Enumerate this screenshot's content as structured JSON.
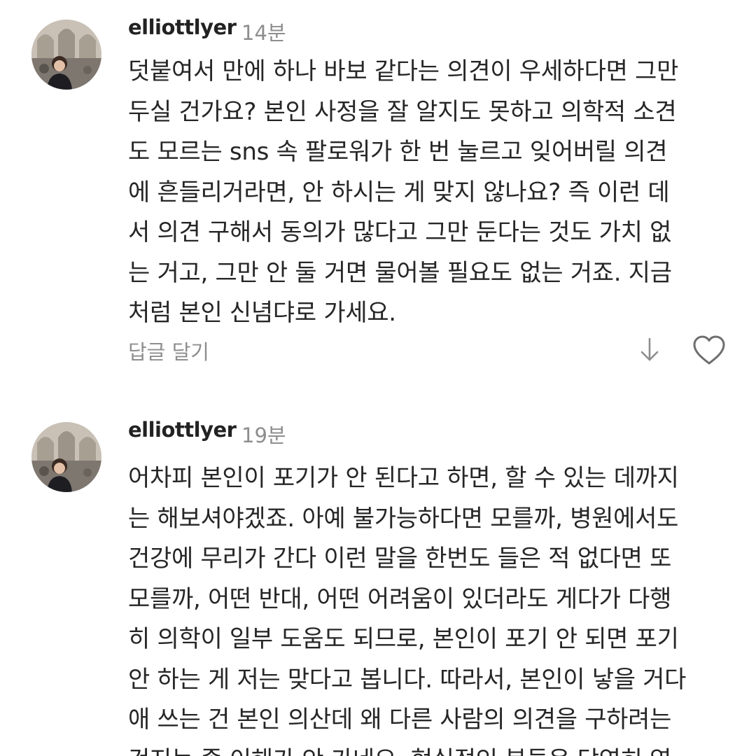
{
  "comments": [
    {
      "username": "elliottlyer",
      "timestamp": "14분",
      "lines": [
        "덧붙여서 만에 하나 바보 같다는 의견이 우세하다면 그만",
        "두실 건가요? 본인 사정을 잘 알지도 못하고 의학적 소견",
        "도 모르는 sns 속 팔로워가 한 번 눌르고 잊어버릴 의견",
        "에 흔들리거라면, 안 하시는 게 맞지 않나요? 즉 이런 데",
        "서 의견 구해서 동의가 많다고 그만 둔다는 것도 가치 없",
        "는 거고, 그만 안 둘 거면 물어볼 필요도 없는 거죠. 지금",
        "처럼 본인 신념댜로 가세요."
      ],
      "reply_label": "답글 달기",
      "icons": [
        "arrow-down-icon",
        "heart-icon"
      ]
    },
    {
      "username": "elliottlyer",
      "timestamp": "19분",
      "lines": [
        "어차피 본인이 포기가 안 된다고 하면, 할 수 있는 데까지",
        "는 해보셔야겠죠. 아예 불가능하다면 모를까, 병원에서도",
        "건강에 무리가 간다 이런 말을 한번도 들은 적 없다면 또",
        "모를까, 어떤 반대, 어떤 어려움이 있더라도 게다가 다행",
        "히 의학이 일부 도움도 되므로, 본인이 포기 안 되면 포기",
        "안 하는 게 저는 맞다고 봅니다. 따라서, 본인이 낳을 거다",
        "애 쓰는 건 본인 의산데 왜 다른 사람의 의견을 구하려는",
        "건지는 좀 이해가 안 가네요. 현실적인 분들은 당연히 염"
      ]
    }
  ],
  "colors": {
    "text": "#262626",
    "muted": "#8e8e8e",
    "background": "#ffffff"
  }
}
